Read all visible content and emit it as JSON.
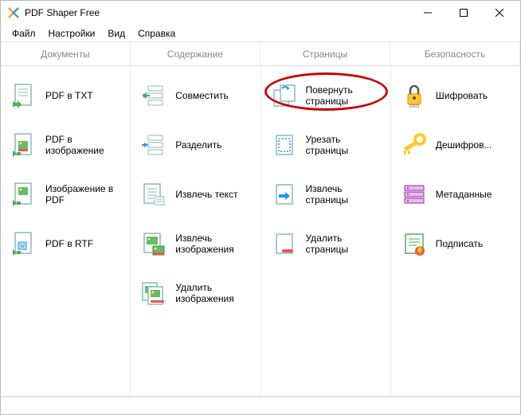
{
  "window": {
    "title": "PDF Shaper Free"
  },
  "menu": {
    "file": "Файл",
    "settings": "Настройки",
    "view": "Вид",
    "help": "Справка"
  },
  "tabs": {
    "documents": "Документы",
    "content": "Содержание",
    "pages": "Страницы",
    "security": "Безопасность"
  },
  "tools": {
    "pdf_to_txt": "PDF в TXT",
    "pdf_to_image": "PDF в изображение",
    "image_to_pdf": "Изображение в PDF",
    "pdf_to_rtf": "PDF в RTF",
    "merge": "Совместить",
    "split": "Разделить",
    "extract_text": "Извлечь текст",
    "extract_images": "Извлечь изображения",
    "delete_images": "Удалить изображения",
    "rotate_pages": "Повернуть страницы",
    "crop_pages": "Урезать страницы",
    "extract_pages": "Извлечь страницы",
    "delete_pages": "Удалить страницы",
    "encrypt": "Шифровать",
    "decrypt": "Дешифров...",
    "metadata": "Метаданные",
    "sign": "Подписать"
  }
}
